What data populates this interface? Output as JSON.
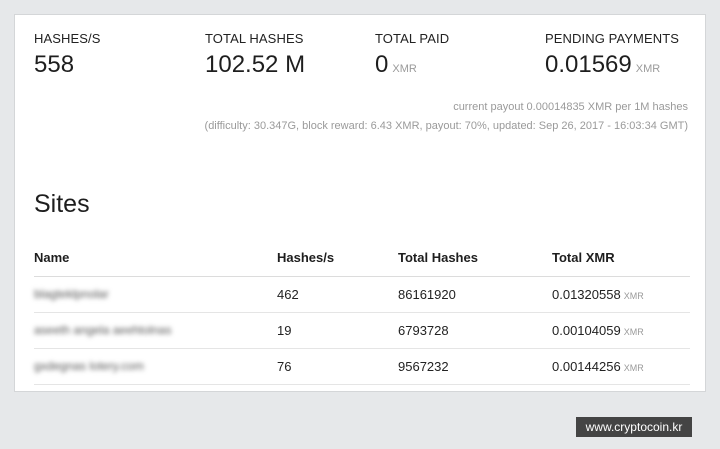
{
  "stats": [
    {
      "label": "HASHES/S",
      "value": "558",
      "unit": ""
    },
    {
      "label": "TOTAL HASHES",
      "value": "102.52 M",
      "unit": ""
    },
    {
      "label": "TOTAL PAID",
      "value": "0",
      "unit": "XMR"
    },
    {
      "label": "PENDING PAYMENTS",
      "value": "0.01569",
      "unit": "XMR"
    }
  ],
  "meta": {
    "payout": "current payout 0.00014835 XMR per 1M hashes",
    "details": "(difficulty: 30.347G, block reward: 6.43 XMR, payout: 70%, updated: Sep 26, 2017 - 16:03:34 GMT)"
  },
  "sites": {
    "title": "Sites",
    "columns": [
      "Name",
      "Hashes/s",
      "Total Hashes",
      "Total XMR"
    ],
    "rows": [
      {
        "name": "blagteklpnolar",
        "hashes": "462",
        "total": "86161920",
        "xmr": "0.01320558",
        "unit": "XMR"
      },
      {
        "name": "aseeth angela aeehtolnas",
        "hashes": "19",
        "total": "6793728",
        "xmr": "0.00104059",
        "unit": "XMR"
      },
      {
        "name": "gxdegnas lotery.com",
        "hashes": "76",
        "total": "9567232",
        "xmr": "0.00144256",
        "unit": "XMR"
      }
    ]
  },
  "watermark": "www.cryptocoin.kr"
}
